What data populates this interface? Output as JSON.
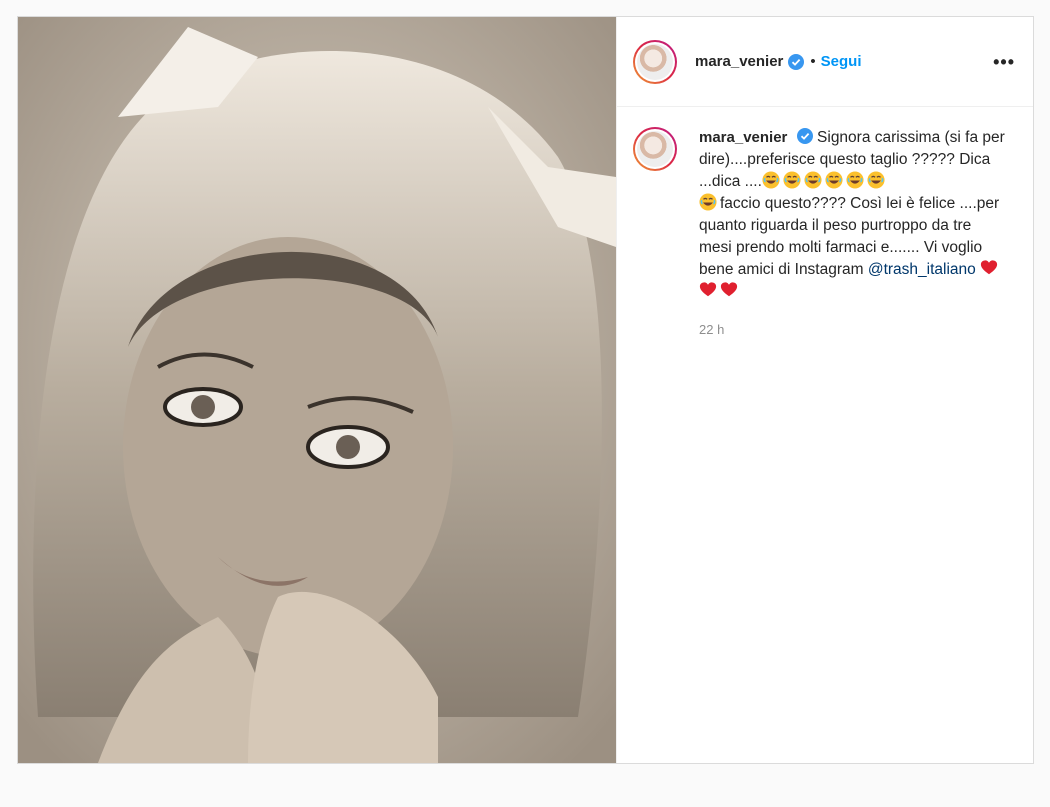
{
  "post": {
    "username": "mara_venier",
    "follow_label": "Segui",
    "separator": "•",
    "more_label": "•••",
    "photo_alt": "",
    "caption": {
      "username": "mara_venier",
      "line1": "Signora carissima (si fa per dire)....preferisce questo taglio ????? Dica ...dica ....",
      "line2": "faccio questo???? Così lei è felice ....per quanto riguarda il peso purtroppo da tre mesi prendo molti farmaci e....... Vi voglio bene amici di Instagram ",
      "mention": "@trash_italiano",
      "timestamp": "22 h"
    }
  },
  "colors": {
    "accent": "#0095f6",
    "mention": "#00376b",
    "verified": "#3897f0",
    "heart": "#e0202f"
  },
  "icons": [
    "verified-badge-icon",
    "more-options-icon",
    "laughing-emoji-icon",
    "red-heart-icon"
  ]
}
